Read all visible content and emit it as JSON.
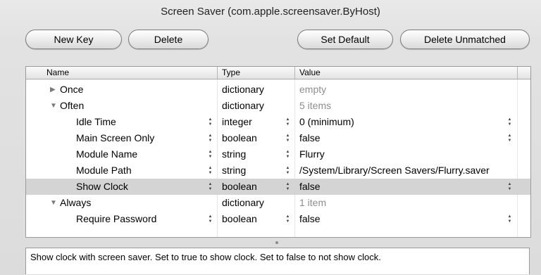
{
  "window": {
    "title": "Screen Saver (com.apple.screensaver.ByHost)"
  },
  "toolbar": {
    "new_key": "New Key",
    "delete": "Delete",
    "set_default": "Set Default",
    "delete_unmatched": "Delete Unmatched"
  },
  "table": {
    "columns": {
      "name": "Name",
      "type": "Type",
      "value": "Value"
    },
    "rows": [
      {
        "name": "Once",
        "type": "dictionary",
        "value": "empty"
      },
      {
        "name": "Often",
        "type": "dictionary",
        "value": "5 items"
      },
      {
        "name": "Idle Time",
        "type": "integer",
        "value": "0 (minimum)"
      },
      {
        "name": "Main Screen Only",
        "type": "boolean",
        "value": "false"
      },
      {
        "name": "Module Name",
        "type": "string",
        "value": "Flurry"
      },
      {
        "name": "Module Path",
        "type": "string",
        "value": "/System/Library/Screen Savers/Flurry.saver"
      },
      {
        "name": "Show Clock",
        "type": "boolean",
        "value": "false"
      },
      {
        "name": "Always",
        "type": "dictionary",
        "value": "1 item"
      },
      {
        "name": "Require Password",
        "type": "boolean",
        "value": "false"
      }
    ]
  },
  "description": "Show clock with screen saver. Set to true to show clock. Set to false to not show clock.",
  "icons": {
    "collapsed": "disclosure-triangle-right-icon",
    "expanded": "disclosure-triangle-down-icon",
    "stepper": "up-down-stepper-icon"
  }
}
